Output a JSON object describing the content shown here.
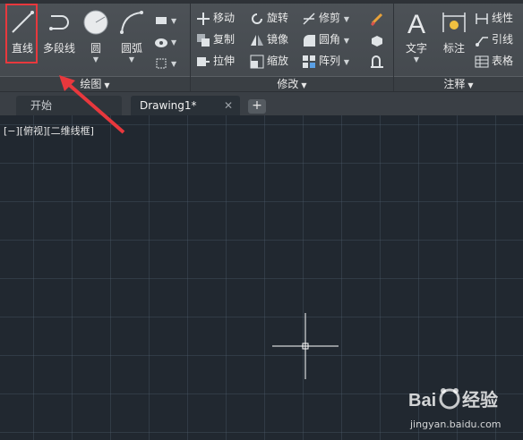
{
  "ribbon": {
    "draw_panel": {
      "title": "绘图",
      "buttons": {
        "line": "直线",
        "polyline": "多段线",
        "circle": "圆",
        "arc": "圆弧"
      }
    },
    "modify_panel": {
      "title": "修改",
      "items": {
        "move": "移动",
        "copy": "复制",
        "stretch": "拉伸",
        "rotate": "旋转",
        "mirror": "镜像",
        "scale": "缩放",
        "trim": "修剪",
        "fillet": "圆角",
        "array": "阵列"
      }
    },
    "annotation_panel": {
      "title": "注释",
      "buttons": {
        "text": "文字",
        "dimension": "标注"
      },
      "items": {
        "linear": "线性",
        "leader": "引线",
        "table": "表格"
      }
    }
  },
  "tabs": {
    "start": "开始",
    "drawing": "Drawing1*",
    "close": "✕",
    "add": "+"
  },
  "viewport": {
    "label": "[−][俯视][二维线框]"
  },
  "watermark": {
    "brand": "Bai 经验",
    "url": "jingyan.baidu.com"
  },
  "colors": {
    "accent_highlight": "#e8383d",
    "canvas_bg": "#212830",
    "ribbon_bg": "#4a4f54"
  }
}
